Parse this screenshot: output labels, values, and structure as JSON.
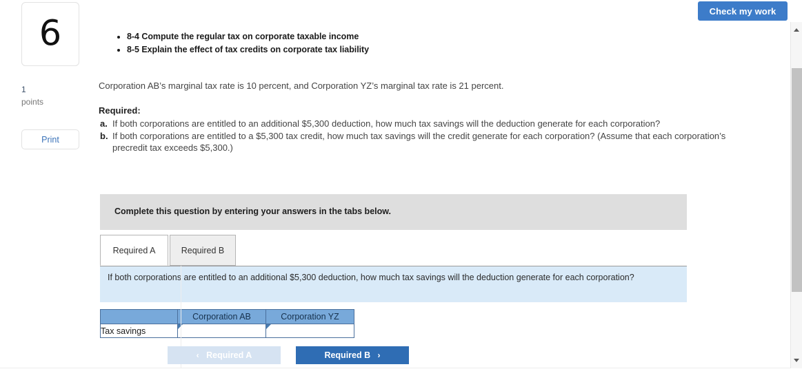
{
  "question": {
    "number": "6",
    "points_value": "1",
    "points_label": "points",
    "print_label": "Print"
  },
  "toolbar": {
    "check_my_work_label": "Check my work"
  },
  "objectives": [
    "8-4 Compute the regular tax on corporate taxable income",
    "8-5 Explain the effect of tax credits on corporate tax liability"
  ],
  "scenario": "Corporation AB’s marginal tax rate is 10 percent, and Corporation YZ’s marginal tax rate is 21 percent.",
  "required": {
    "heading": "Required:",
    "items": [
      {
        "marker": "a.",
        "text": "If both corporations are entitled to an additional $5,300 deduction, how much tax savings will the deduction generate for each corporation?"
      },
      {
        "marker": "b.",
        "text": "If both corporations are entitled to a $5,300 tax credit, how much tax savings will the credit generate for each corporation? (Assume that each corporation’s precredit tax exceeds $5,300.)"
      }
    ]
  },
  "instruction_bar": {
    "text": "Complete this question by entering your answers in the tabs below."
  },
  "tabs": [
    {
      "label": "Required A",
      "active": true
    },
    {
      "label": "Required B",
      "active": false
    }
  ],
  "answer_panel": {
    "prompt": "If both corporations are entitled to an additional $5,300 deduction, how much tax savings will the deduction generate for each corporation?",
    "table": {
      "corner_header": "",
      "column_headers": [
        "Corporation AB",
        "Corporation YZ"
      ],
      "rows": [
        {
          "label": "Tax savings",
          "values": [
            "",
            ""
          ]
        }
      ]
    }
  },
  "pager": {
    "prev_label": "Required A",
    "prev_chevron": "‹",
    "next_label": "Required B",
    "next_chevron": "›"
  },
  "colors": {
    "primary_blue": "#3d7cc9",
    "next_blue": "#2f6db4",
    "disabled_blue": "#d6e3f2",
    "table_header_blue": "#78a9da",
    "panel_blue": "#d9eaf8",
    "instruction_gray": "#dedede"
  }
}
